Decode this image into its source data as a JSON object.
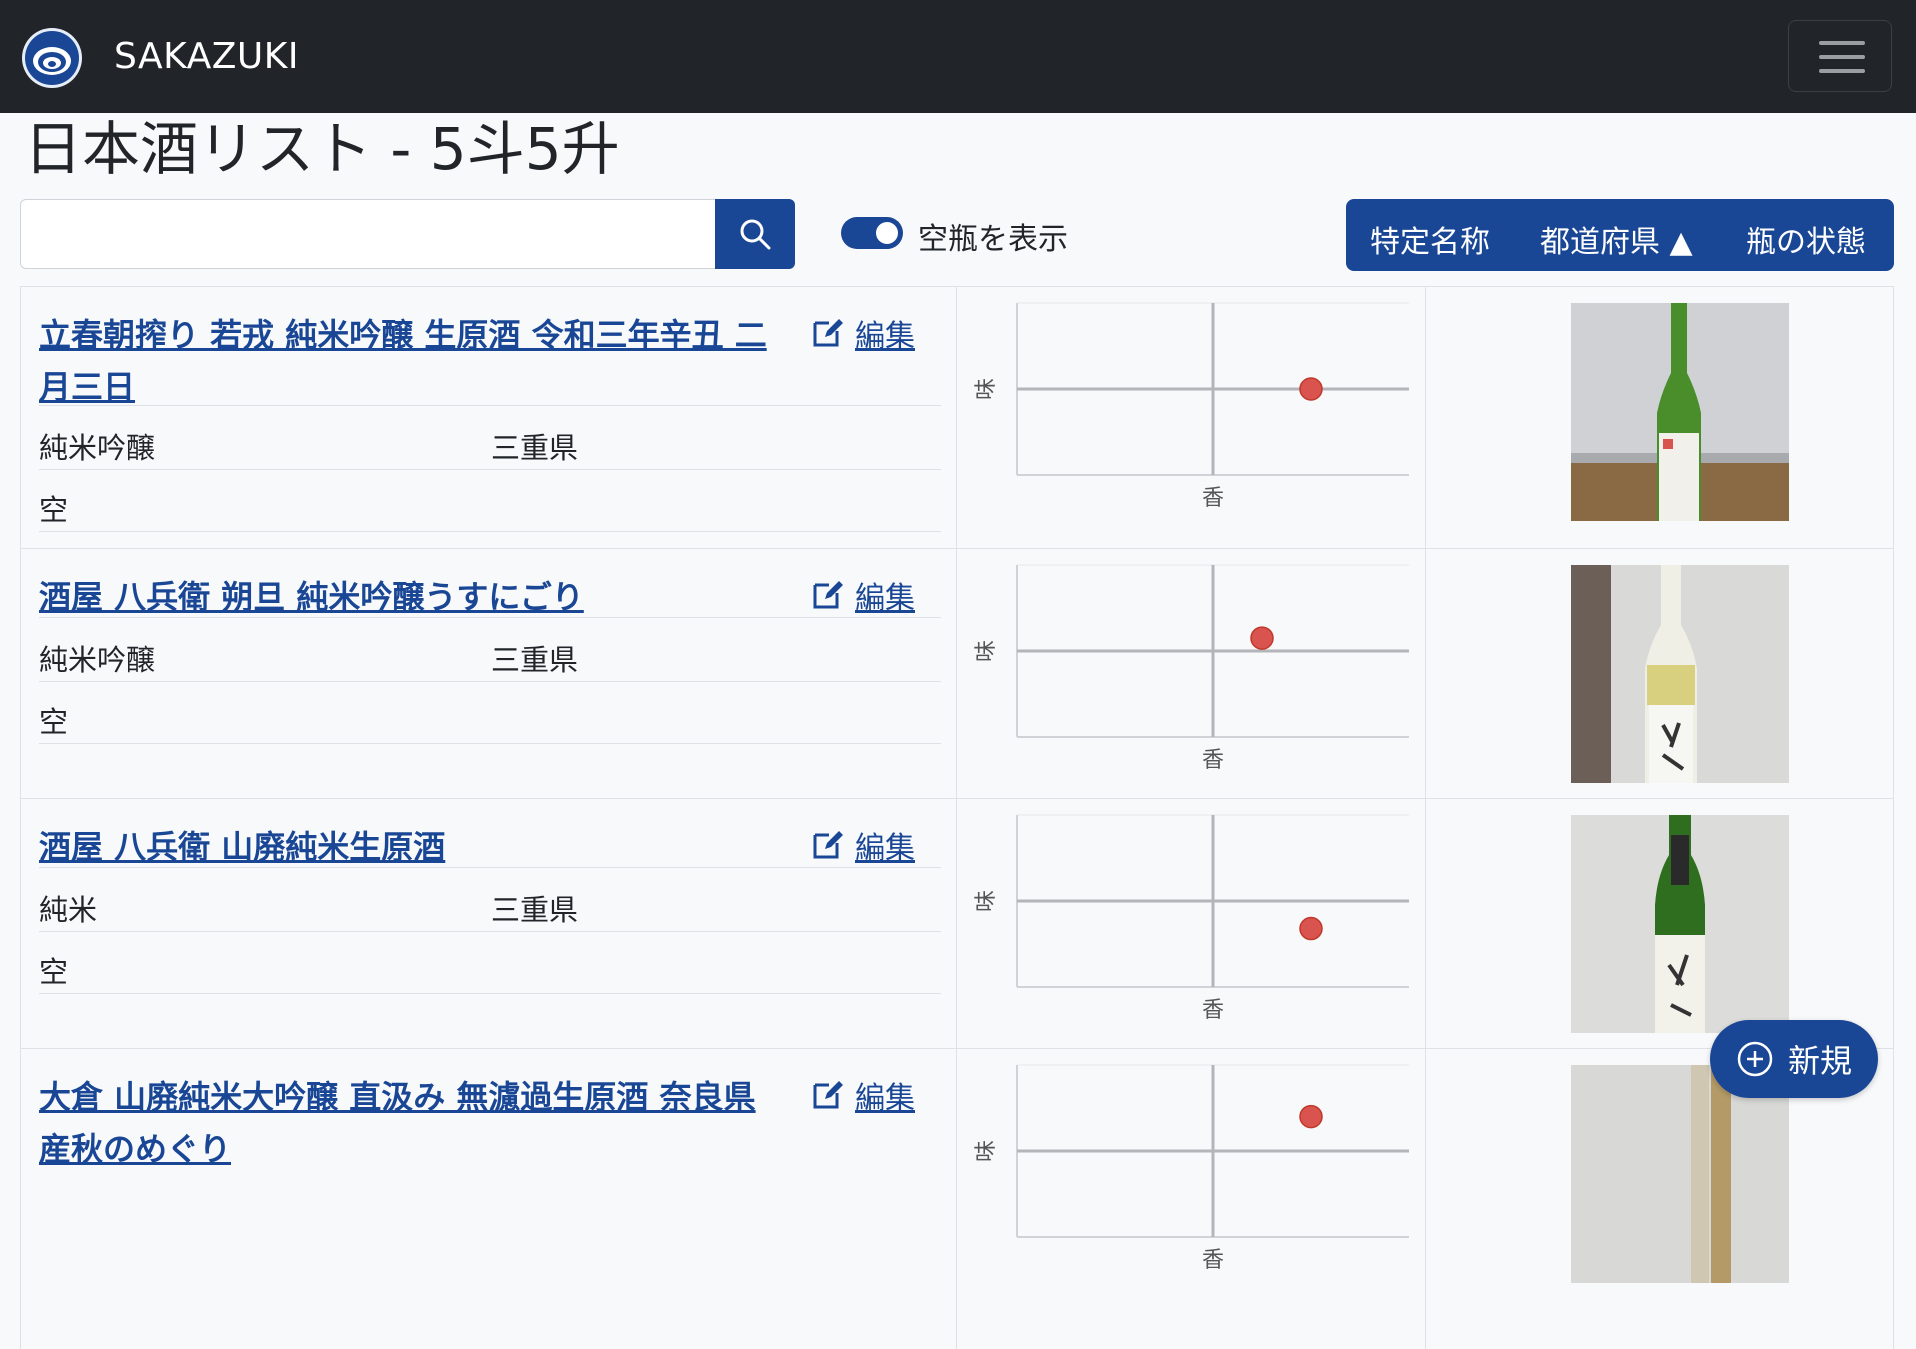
{
  "app": {
    "brand": "SAKAZUKI"
  },
  "header": {
    "title": "日本酒リスト - 5斗5升"
  },
  "search": {
    "placeholder": "",
    "value": ""
  },
  "filter": {
    "show_empty_label": "空瓶を表示",
    "show_empty_on": true
  },
  "sort": {
    "items": [
      "特定名称",
      "都道府県 ▲",
      "瓶の状態"
    ]
  },
  "edit_label": "編集",
  "chart_axes": {
    "x_label": "香",
    "y_label": "味"
  },
  "items": [
    {
      "name": "立春朝搾り 若戎 純米吟醸 生原酒 令和三年辛丑 二月三日",
      "grade": "純米吟醸",
      "prefecture": "三重県",
      "status": "空",
      "aroma": 0.5,
      "taste": 0.0
    },
    {
      "name": "酒屋 八兵衛 朔旦 純米吟醸うすにごり",
      "grade": "純米吟醸",
      "prefecture": "三重県",
      "status": "空",
      "aroma": 0.25,
      "taste": 0.15
    },
    {
      "name": "酒屋 八兵衛 山廃純米生原酒",
      "grade": "純米",
      "prefecture": "三重県",
      "status": "空",
      "aroma": 0.5,
      "taste": -0.32
    },
    {
      "name": "大倉 山廃純米大吟醸 直汲み 無濾過生原酒 奈良県産秋のめぐり",
      "grade": "",
      "prefecture": "",
      "status": "",
      "aroma": 0.5,
      "taste": 0.4
    }
  ],
  "new_button": {
    "label": "新規"
  },
  "colors": {
    "navbar": "#212529",
    "primary": "#1a4795",
    "point": "#d9534f"
  }
}
